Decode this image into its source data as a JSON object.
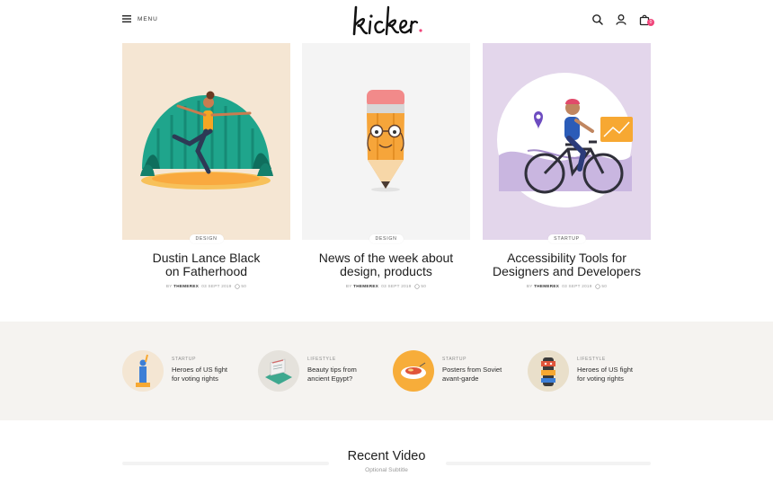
{
  "header": {
    "menu_label": "MENU",
    "logo_text": "kicker",
    "icons": [
      "search-icon",
      "user-icon",
      "cart-icon"
    ],
    "cart_count": "0"
  },
  "colors": {
    "accent": "#f0457a",
    "strip_background": "#f5f3f0",
    "card1_background": "#f5e6d3",
    "card2_background": "#f4f4f4",
    "card3_background": "#e3d6eb"
  },
  "featured": [
    {
      "category": "DESIGN",
      "title": "Dustin Lance Black\non Fatherhood",
      "by": "BY",
      "author": "THEMEREX",
      "date": "03 SEPT 2019",
      "comments": "50"
    },
    {
      "category": "DESIGN",
      "title": "News of the week about\ndesign, products",
      "by": "BY",
      "author": "THEMEREX",
      "date": "03 SEPT 2019",
      "comments": "50"
    },
    {
      "category": "STARTUP",
      "title": "Accessibility Tools for\nDesigners and Developers",
      "by": "BY",
      "author": "THEMEREX",
      "date": "03 SEPT 2019",
      "comments": "50"
    }
  ],
  "strip": [
    {
      "category": "STARTUP",
      "title": "Heroes of US fight\nfor voting rights"
    },
    {
      "category": "LIFESTYLE",
      "title": "Beauty tips from\nancient Egypt?"
    },
    {
      "category": "STARTUP",
      "title": "Posters from Soviet\navant-garde"
    },
    {
      "category": "LIFESTYLE",
      "title": "Heroes of US fight\nfor voting rights"
    }
  ],
  "recent_video": {
    "title": "Recent Video",
    "subtitle": "Optional Subtitle"
  }
}
